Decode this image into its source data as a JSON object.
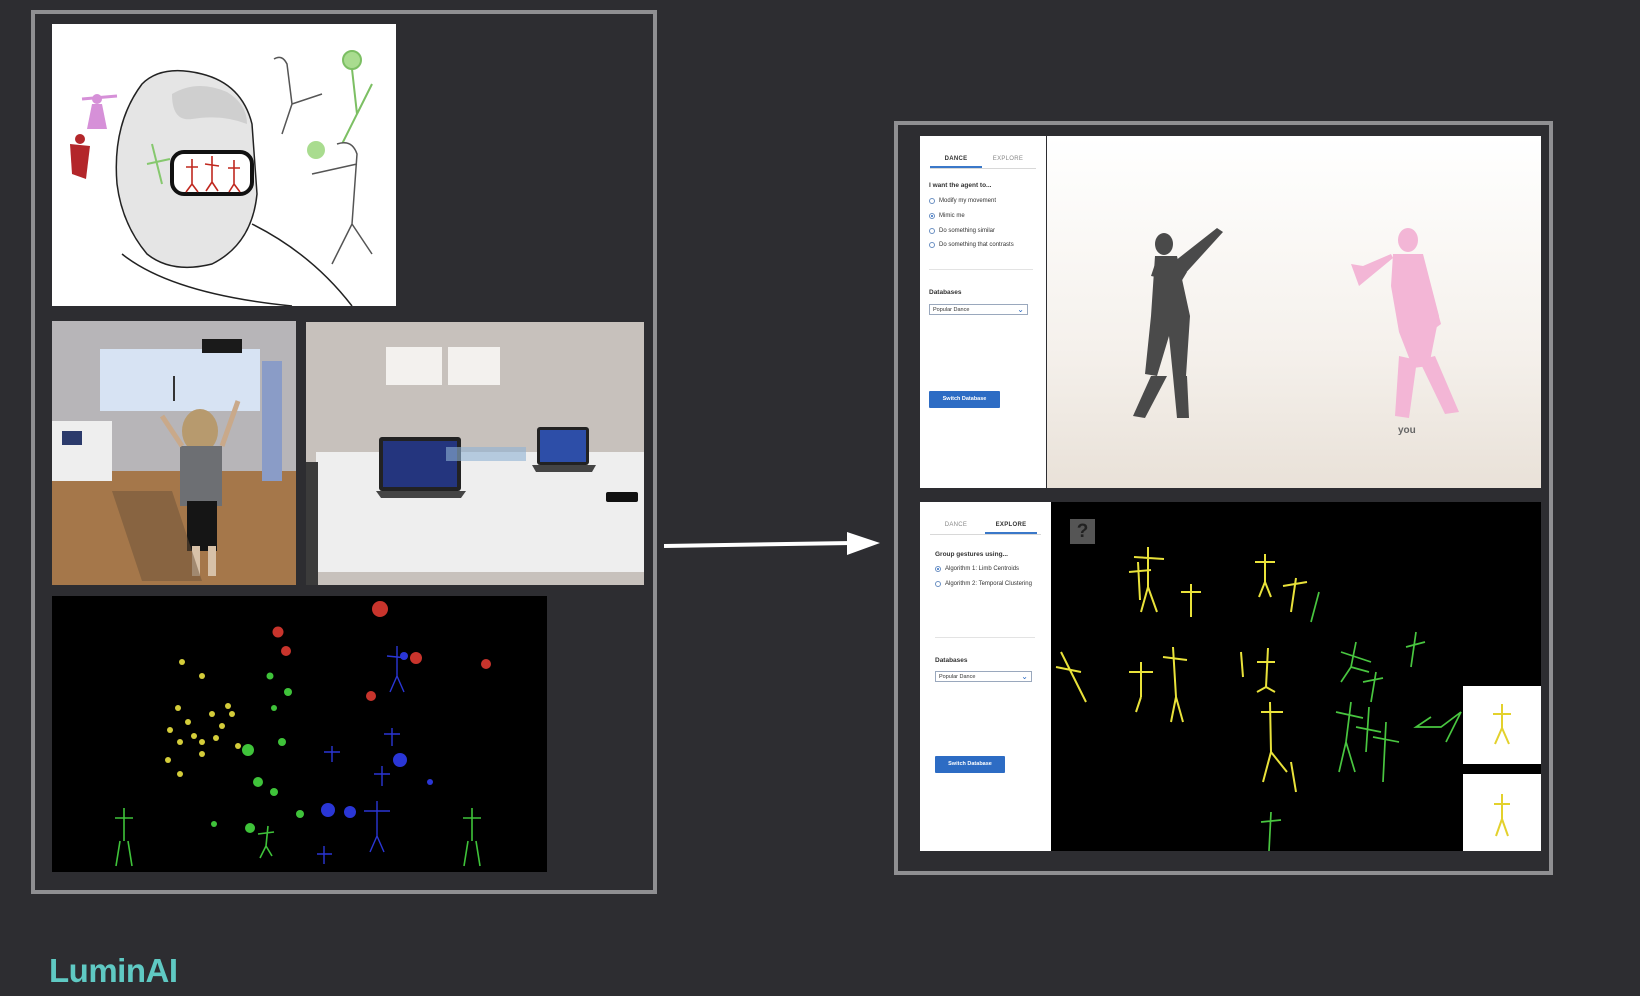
{
  "brand": {
    "logo_text": "LuminAI",
    "accent": "#5fc9c3"
  },
  "left_panel": {
    "illustration": "vr-headset-illustration",
    "photos": [
      "projection-installation-photo",
      "laptops-table-photo"
    ],
    "visualization": "skeleton-cluster-visualization"
  },
  "dance_ui": {
    "tabs": [
      "DANCE",
      "EXPLORE"
    ],
    "active_tab": "DANCE",
    "prompt": "I want the agent to...",
    "options": [
      {
        "label": "Modify my movement",
        "selected": false
      },
      {
        "label": "Mimic me",
        "selected": true
      },
      {
        "label": "Do something similar",
        "selected": false
      },
      {
        "label": "Do something that contrasts",
        "selected": false
      }
    ],
    "databases_label": "Databases",
    "database_value": "Popular Dance",
    "switch_button": "Switch Database",
    "you_label": "you"
  },
  "explore_ui": {
    "tabs": [
      "DANCE",
      "EXPLORE"
    ],
    "active_tab": "EXPLORE",
    "prompt": "Group gestures using...",
    "options": [
      {
        "label": "Algorithm 1: Limb Centroids",
        "selected": true
      },
      {
        "label": "Algorithm 2: Temporal Clustering",
        "selected": false
      }
    ],
    "databases_label": "Databases",
    "database_value": "Popular Dance",
    "switch_button": "Switch Database",
    "help_icon_text": "?"
  },
  "colors": {
    "background": "#2d2d31",
    "frame": "#8f8f92",
    "primary_button": "#2d6cc4",
    "agent": "#4a4a4a",
    "user": "#f3b6d6"
  }
}
